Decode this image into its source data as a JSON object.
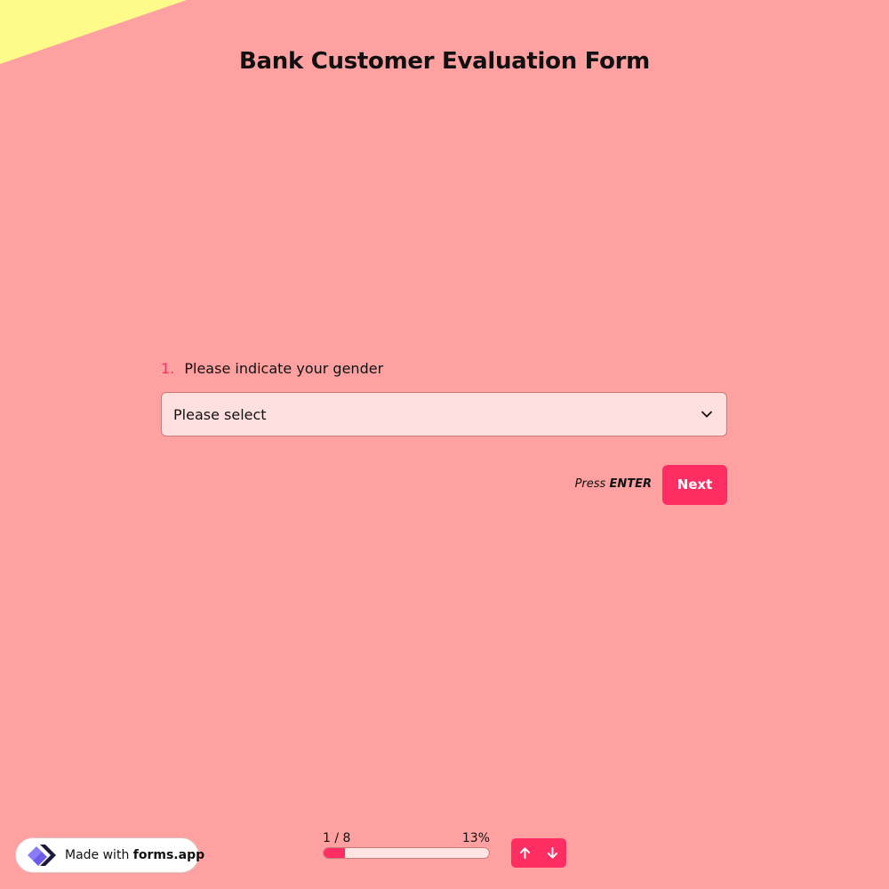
{
  "form": {
    "title": "Bank Customer Evaluation Form"
  },
  "question": {
    "number": "1.",
    "label": "Please indicate your gender",
    "select": {
      "selected_value": "Please select",
      "icon": "chevron-down-icon"
    }
  },
  "actions": {
    "hint_prefix": "Press",
    "hint_key": "ENTER",
    "next_label": "Next"
  },
  "badge": {
    "prefix": "Made with",
    "brand": "forms.app",
    "icon": "forms-app-logo"
  },
  "progress": {
    "count": "1 / 8",
    "percent_label": "13%",
    "fraction": 0.13
  },
  "navigation": {
    "up_icon": "arrow-up-icon",
    "down_icon": "arrow-down-icon"
  },
  "colors": {
    "background": "#ffa1a1",
    "accent": "#ff2d62",
    "corner": "#fdfb8a",
    "input_background": "#ffe0e0"
  }
}
